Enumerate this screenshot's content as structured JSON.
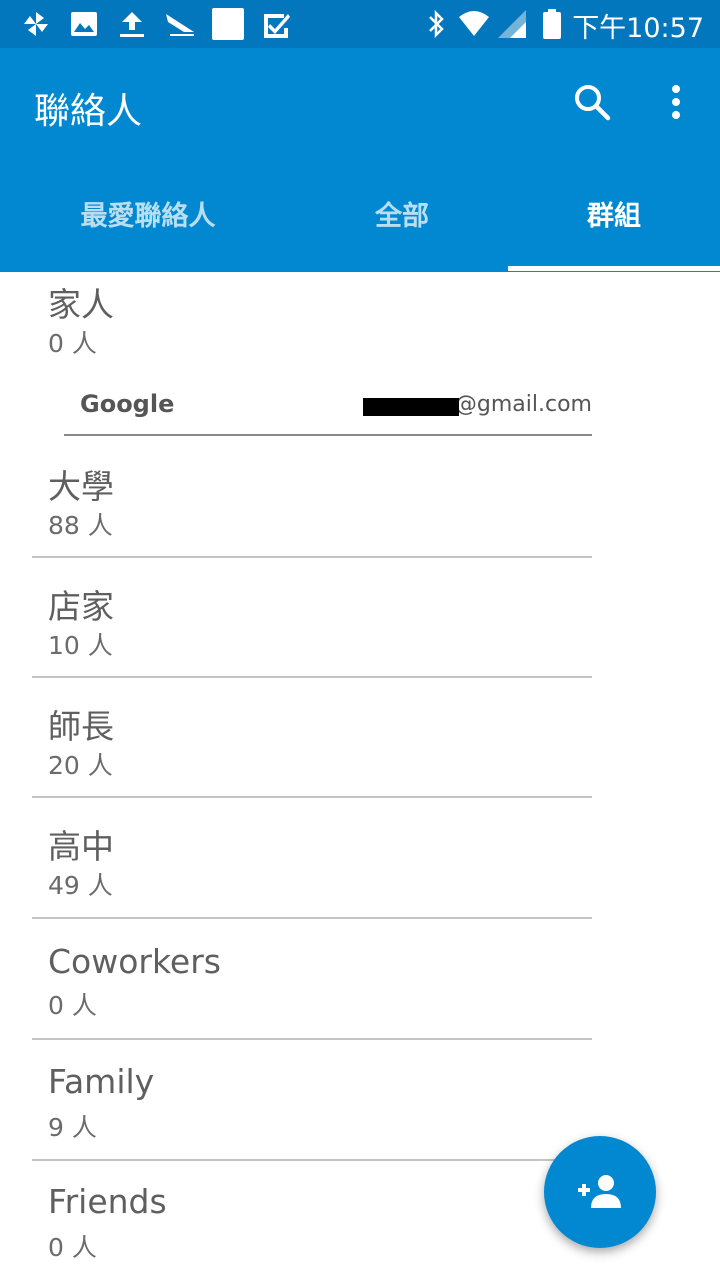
{
  "status_bar": {
    "time": "下午10:57",
    "left_icons": [
      "pinwheel-icon",
      "image-icon",
      "upload-icon",
      "plane-icon",
      "blank-square-icon",
      "checkbox-icon"
    ],
    "right_icons": [
      "bluetooth-icon",
      "wifi-icon",
      "signal-icon",
      "battery-icon"
    ]
  },
  "app_bar": {
    "title": "聯絡人",
    "actions": [
      "search-icon",
      "more-vert-icon"
    ],
    "color": "#0288d1"
  },
  "tabs": [
    {
      "label": "最愛聯絡人",
      "active": false
    },
    {
      "label": "全部",
      "active": false
    },
    {
      "label": "群組",
      "active": true
    }
  ],
  "groups_top": [
    {
      "name": "家人",
      "count": "0 人"
    }
  ],
  "account": {
    "type": "Google",
    "email_visible": "@gmail.com"
  },
  "groups": [
    {
      "name": "大學",
      "count": "88 人"
    },
    {
      "name": "店家",
      "count": "10 人"
    },
    {
      "name": "師長",
      "count": "20 人"
    },
    {
      "name": "高中",
      "count": "49 人"
    },
    {
      "name": "Coworkers",
      "count": "0 人"
    },
    {
      "name": "Family",
      "count": "9 人"
    },
    {
      "name": "Friends",
      "count": "0 人"
    }
  ],
  "fab": {
    "icon": "add-person-icon"
  }
}
